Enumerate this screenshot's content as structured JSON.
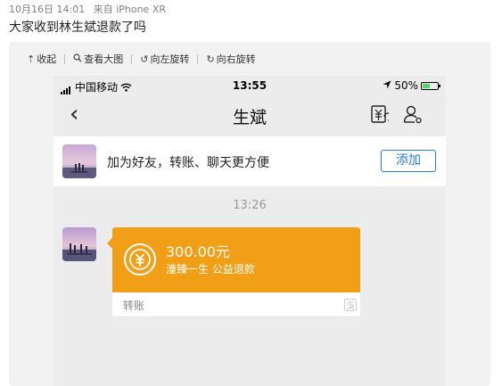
{
  "post": {
    "date": "10月16日 14:01",
    "source": "来自 iPhone XR",
    "text": "大家收到林生斌退款了吗"
  },
  "viewer_toolbar": {
    "collapse": "收起",
    "view_large": "查看大图",
    "rotate_left": "向左旋转",
    "rotate_right": "向右旋转"
  },
  "phone": {
    "status_bar": {
      "carrier": "中国移动",
      "time": "13:55",
      "battery_percent": "50%",
      "battery_level": 0.5
    },
    "nav": {
      "title": "生斌"
    },
    "add_friend_bar": {
      "text": "加为好友，转账、聊天更方便",
      "button": "添加"
    },
    "chat": {
      "time": "13:26",
      "transfer": {
        "amount": "300.00元",
        "note": "潼臻一生 公益退款",
        "label": "转账"
      }
    }
  },
  "colors": {
    "transfer_orange": "#f09f17",
    "link_blue": "#2a7bd1",
    "chat_bg": "#ececec",
    "battery_green": "#4cd964"
  },
  "icons": [
    "collapse-icon",
    "zoom-icon",
    "rotate-left-icon",
    "rotate-right-icon",
    "signal-icon",
    "wifi-icon",
    "location-arrow-icon",
    "battery-icon",
    "back-chevron-icon",
    "transfer-icon",
    "profile-icon",
    "yuan-circle-icon",
    "alipay-icon"
  ]
}
